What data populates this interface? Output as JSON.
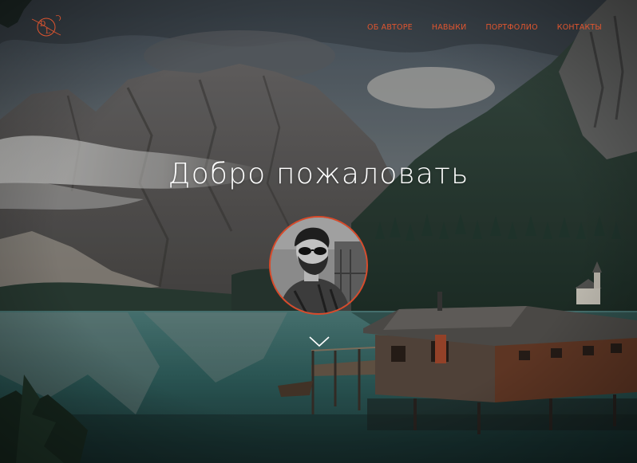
{
  "header": {
    "logo_letters": "DL",
    "nav": [
      {
        "label": "ОБ АВТОРЕ"
      },
      {
        "label": "НАВЫКИ"
      },
      {
        "label": "ПОРТФОЛИО"
      },
      {
        "label": "КОНТАКТЫ"
      }
    ]
  },
  "hero": {
    "title": "Добро пожаловать",
    "background": "mountain-lake-photo",
    "avatar": "author-photo"
  },
  "colors": {
    "accent": "#e0552f",
    "title": "#ffffff"
  },
  "icons": {
    "scroll": "chevron-down-icon"
  }
}
